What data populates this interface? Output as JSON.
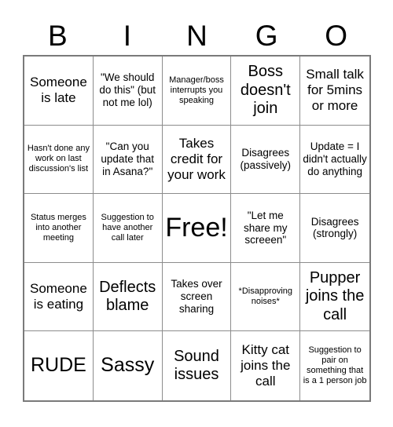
{
  "title": "BINGO",
  "header": {
    "letters": [
      "B",
      "I",
      "N",
      "G",
      "O"
    ]
  },
  "grid": {
    "rows": 5,
    "columns": 5,
    "border_color": "#7a7a7a",
    "line_color": "#8c8c8c",
    "background": "#ffffff",
    "text_color": "#000000",
    "free_space_index": 12
  },
  "cells": [
    {
      "text": "Someone is late",
      "size": "md"
    },
    {
      "text": "\"We should do this\" (but not me lol)",
      "size": "sm"
    },
    {
      "text": "Manager/boss interrupts you speaking",
      "size": "xs"
    },
    {
      "text": "Boss doesn't join",
      "size": "lg"
    },
    {
      "text": "Small talk for 5mins or more",
      "size": "md"
    },
    {
      "text": "Hasn't done any work on last discussion's list",
      "size": "xs"
    },
    {
      "text": "\"Can you update that in Asana?\"",
      "size": "sm"
    },
    {
      "text": "Takes credit for your work",
      "size": "md"
    },
    {
      "text": "Disagrees (passively)",
      "size": "sm"
    },
    {
      "text": "Update = I didn't actually do anything",
      "size": "sm"
    },
    {
      "text": "Status merges into another meeting",
      "size": "xs"
    },
    {
      "text": "Suggestion to have another call later",
      "size": "xs"
    },
    {
      "text": "Free!",
      "size": "xxl"
    },
    {
      "text": "\"Let me share my screeen\"",
      "size": "sm"
    },
    {
      "text": "Disagrees (strongly)",
      "size": "sm"
    },
    {
      "text": "Someone is eating",
      "size": "md"
    },
    {
      "text": "Deflects blame",
      "size": "lg"
    },
    {
      "text": "Takes over screen sharing",
      "size": "sm"
    },
    {
      "text": "*Disapproving noises*",
      "size": "xs"
    },
    {
      "text": "Pupper joins the call",
      "size": "lg"
    },
    {
      "text": "RUDE",
      "size": "xl"
    },
    {
      "text": "Sassy",
      "size": "xl"
    },
    {
      "text": "Sound issues",
      "size": "lg"
    },
    {
      "text": "Kitty cat joins the call",
      "size": "md"
    },
    {
      "text": "Suggestion to pair on something that is a 1 person job",
      "size": "xs"
    }
  ]
}
